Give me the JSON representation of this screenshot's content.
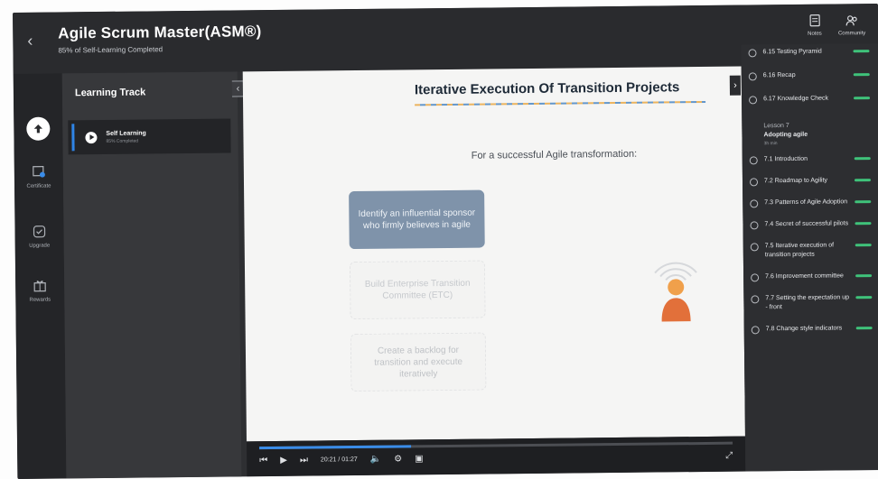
{
  "header": {
    "title": "Agile Scrum Master(ASM®)",
    "progress_text": "85% of Self-Learning Completed",
    "actions": [
      {
        "label": "Notes",
        "icon": "notes-icon"
      },
      {
        "label": "Community",
        "icon": "community-icon"
      }
    ]
  },
  "rail": {
    "items": [
      {
        "label": "",
        "icon": "learning-icon"
      },
      {
        "label": "Certificate",
        "icon": "certificate-icon"
      },
      {
        "label": "Upgrade",
        "icon": "upgrade-icon"
      },
      {
        "label": "Rewards",
        "icon": "rewards-icon"
      }
    ]
  },
  "track": {
    "heading": "Learning Track",
    "item_title": "Self Learning",
    "item_sub": "85% Completed"
  },
  "slide": {
    "title": "Iterative Execution Of Transition Projects",
    "subtitle": "For a successful Agile transformation:",
    "box1": "Identify an influential sponsor who firmly believes in agile",
    "box2": "Build Enterprise Transition Committee (ETC)",
    "box3": "Create a backlog for transition and execute iteratively"
  },
  "player": {
    "time": "20:21 / 01:27",
    "progress": 0.32
  },
  "playlist": {
    "items": [
      {
        "label": "6.15 Testing Pyramid",
        "done": true
      },
      {
        "label": "6.16 Recap",
        "done": true
      },
      {
        "label": "6.17 Knowledge Check",
        "done": true
      }
    ],
    "lesson": {
      "title": "Lesson 7",
      "name": "Adopting agile",
      "meta": "3h min"
    },
    "lesson_items": [
      {
        "label": "7.1 Introduction",
        "done": true
      },
      {
        "label": "7.2 Roadmap to Agility",
        "done": true
      },
      {
        "label": "7.3 Patterns of Agile Adoption",
        "done": true
      },
      {
        "label": "7.4 Secret of successful pilots",
        "done": true
      },
      {
        "label": "7.5 Iterative execution of transition projects",
        "done": true
      },
      {
        "label": "7.6 Improvement committee",
        "done": true
      },
      {
        "label": "7.7 Setting the expectation up - front",
        "done": true
      },
      {
        "label": "7.8 Change style indicators",
        "done": true
      }
    ]
  },
  "colors": {
    "accent": "#2f84e6",
    "complete": "#3fc27a",
    "slide_box": "#7f93aa",
    "person": "#e2703a"
  }
}
